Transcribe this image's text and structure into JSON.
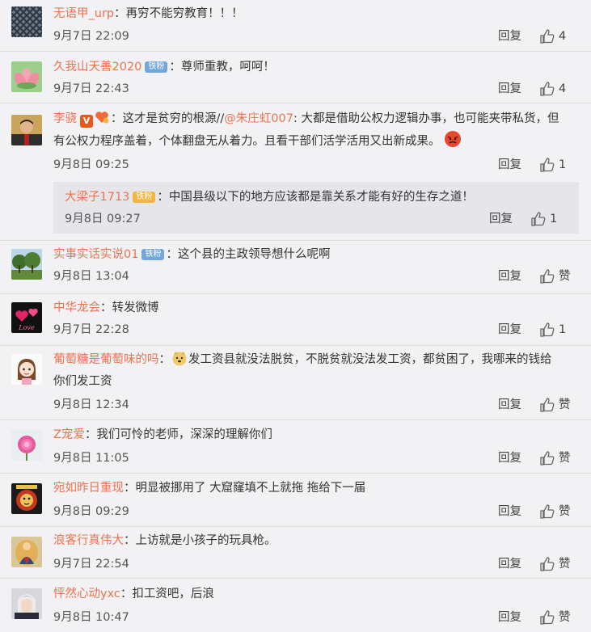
{
  "ui": {
    "reply_label": "回复"
  },
  "comments": [
    {
      "name": "无语甲_urp",
      "text": "：再穷不能穷教育！！！",
      "time": "9月7日 22:09",
      "likes": "4",
      "avatar": "chain-fence"
    },
    {
      "name": "久我山天善2020",
      "badge": "铁粉",
      "text": "：尊师重教，呵呵！",
      "time": "9月7日 22:43",
      "likes": "4",
      "avatar": "lotus"
    },
    {
      "name": "李骁",
      "mid": "：这才是贫穷的根源//",
      "mention": "@朱庄虹007",
      "text_after": ":  大都是借助公权力逻辑办事，也可能夹带私货，但",
      "line2": "有公权力程序盖着，个体翻盘无从着力。且看干部们活学活用又出新成果。",
      "time": "9月8日 09:25",
      "likes": "1",
      "avatar": "man-portrait"
    },
    {
      "name": "实事实话实说01",
      "badge": "铁粉",
      "text": "：这个县的主政领导想什么呢啊",
      "time": "9月8日 13:04",
      "likes": "赞",
      "avatar": "trees"
    },
    {
      "name": "中华龙会",
      "text": "：转发微博",
      "time": "9月7日 22:28",
      "likes": "1",
      "avatar": "love-hearts"
    },
    {
      "name": "葡萄糖是葡萄味的吗",
      "text_pre": "：",
      "text": "发工资县就没法脱贫，不脱贫就没法发工资，都贫困了，我哪来的钱给",
      "line2": "你们发工资",
      "time": "9月8日 12:34",
      "likes": "赞",
      "avatar": "cartoon-girl"
    },
    {
      "name": "Z宠爱",
      "text": "：我们可怜的老师，深深的理解你们",
      "time": "9月8日 11:05",
      "likes": "赞",
      "avatar": "pink-flower"
    },
    {
      "name": "宛如昨日重现",
      "text": "：明显被挪用了 大窟窿填不上就拖  拖给下一届",
      "time": "9月8日 09:29",
      "likes": "赞",
      "avatar": "lion"
    },
    {
      "name": "浪客行真伟大",
      "text": "：上访就是小孩子的玩具枪。",
      "time": "9月7日 22:54",
      "likes": "赞",
      "avatar": "buddha"
    },
    {
      "name": "怦然心动yxc",
      "text": "：扣工资吧，后浪",
      "time": "9月8日 10:47",
      "likes": "赞",
      "avatar": "anime-man"
    }
  ],
  "subreply": {
    "name": "大梁子1713",
    "badge": "铁粉",
    "text": "：中国县级以下的地方应该都是靠关系才能有好的生存之道！",
    "time": "9月8日 09:27",
    "likes": "1"
  }
}
